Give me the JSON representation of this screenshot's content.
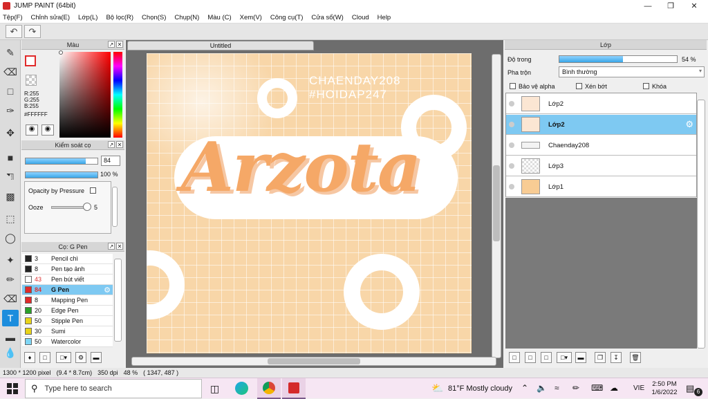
{
  "window": {
    "title": "JUMP PAINT (64bit)"
  },
  "menu": [
    "Tệp(F)",
    "Chỉnh sửa(E)",
    "Lớp(L)",
    "Bộ lọc(R)",
    "Chọn(S)",
    "Chụp(N)",
    "Màu (C)",
    "Xem(V)",
    "Công cụ(T)",
    "Cửa sổ(W)",
    "Cloud",
    "Help"
  ],
  "color_panel": {
    "title": "Màu",
    "r": "R:255",
    "g": "G:255",
    "b": "B:255",
    "hex": "#FFFFFF"
  },
  "brush_control": {
    "title": "Kiểm soát cọ",
    "size_value": "84",
    "opacity_value": "100 %",
    "opacity_by_pressure": "Opacity by Pressure",
    "ooze_label": "Ooze",
    "ooze_value": "5",
    "size_fraction": 0.84,
    "opacity_fraction": 1.0
  },
  "brush_list": {
    "title": "Cọ: G Pen",
    "items": [
      {
        "size": "3",
        "name": "Pencil chì",
        "color": "#222222"
      },
      {
        "size": "8",
        "name": "Pen tạo ảnh",
        "color": "#222222"
      },
      {
        "size": "43",
        "name": "Pen bút viết",
        "color": "#ffffff"
      },
      {
        "size": "84",
        "name": "G Pen",
        "color": "#e02a2a"
      },
      {
        "size": "8",
        "name": "Mapping Pen",
        "color": "#e02a2a"
      },
      {
        "size": "20",
        "name": "Edge Pen",
        "color": "#2aa02a"
      },
      {
        "size": "50",
        "name": "Stipple Pen",
        "color": "#e8d31a"
      },
      {
        "size": "30",
        "name": "Sumi",
        "color": "#e8d31a"
      },
      {
        "size": "50",
        "name": "Watercolor",
        "color": "#7fd6f5"
      }
    ]
  },
  "canvas": {
    "tab_title": "Untitled",
    "art_title": "Arzota",
    "tag_line1": "CHAENDAY208",
    "tag_line2": "#HOIDAP247"
  },
  "layers_panel": {
    "title": "Lớp",
    "opacity_label": "Độ trong",
    "opacity_value": "54 %",
    "opacity_fraction": 0.54,
    "blend_label": "Pha trộn",
    "blend_value": "Bình thường",
    "protect_alpha": "Bảo vệ alpha",
    "clipping": "Xén bớt",
    "lock": "Khóa",
    "layers": [
      {
        "name": "Lớp2",
        "selected": false
      },
      {
        "name": "Lớp2",
        "selected": true
      },
      {
        "name": "Chaenday208",
        "selected": false
      },
      {
        "name": "Lớp3",
        "selected": false
      },
      {
        "name": "Lớp1",
        "selected": false
      }
    ]
  },
  "status": {
    "size": "1300 * 1200 pixel",
    "cm": "(9.4 * 8.7cm)",
    "dpi": "350 dpi",
    "zoom": "48 %",
    "coords": "( 1347, 487 )"
  },
  "taskbar": {
    "search_placeholder": "Type here to search",
    "weather": "81°F Mostly cloudy",
    "lang": "VIE",
    "time": "2:50 PM",
    "date": "1/6/2022",
    "notif": "6"
  }
}
